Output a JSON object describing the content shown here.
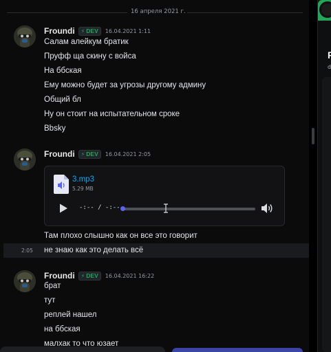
{
  "date_divider": "16 апреля 2021 г.",
  "messages": [
    {
      "author": "Froundi",
      "tag": "DEV",
      "timestamp": "16.04.2021 1:11",
      "lines": [
        "Салам алейкум братик",
        "Пруфф ща скину с войса",
        "На ббская",
        "Ему можно будет за угрозы другому админу",
        "Общий бл",
        "Ну он стоит на испытательном сроке",
        "Bbsky"
      ]
    },
    {
      "author": "Froundi",
      "tag": "DEV",
      "timestamp": "16.04.2021 2:05",
      "attachment": {
        "file_name": "3.mp3",
        "file_size": "5.29 MB",
        "time_display": "-:-- / -:--",
        "progress": 0
      },
      "lines": [
        "Там плохо слышно как он все это говорит",
        "не знаю как это делать всё"
      ],
      "hover_time": "2:05"
    },
    {
      "author": "Froundi",
      "tag": "DEV",
      "timestamp": "16.04.2021 16:22",
      "lines": [
        "брат",
        "тут",
        "реплей нашел",
        "на ббская",
        "малхак то что юзает"
      ]
    }
  ],
  "right_panel": {
    "name_initial": "F",
    "sub": "d"
  },
  "colors": {
    "accent": "#5865f2",
    "tag_green": "#23a55a",
    "link": "#00a8fc"
  }
}
